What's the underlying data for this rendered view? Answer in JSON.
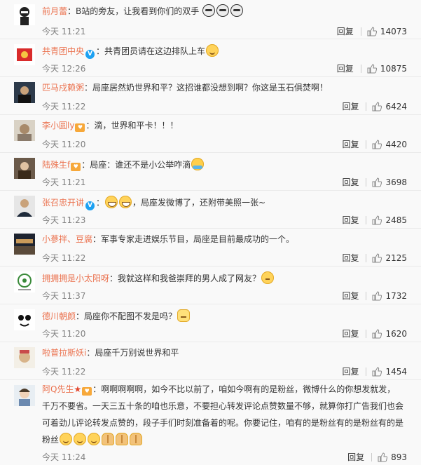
{
  "ui": {
    "reply_label": "回复",
    "colon": "："
  },
  "comments": [
    {
      "user": "前月蕾",
      "text": "B站的旁友，让我看到你们的双手",
      "time": "今天 11:21",
      "likes": "14073"
    },
    {
      "user": "共青团中央",
      "text": "共青团员请在这边排队上车",
      "time": "今天 12:26",
      "likes": "10875"
    },
    {
      "user": "匹马戍赖粥",
      "text": "局座居然奶世界和平？这招谁都没想到啊？你这是玉石俱焚啊！",
      "time": "今天 11:22",
      "likes": "6424"
    },
    {
      "user": "李小圆ly",
      "text": "滴，世界和平卡！！！",
      "time": "今天 11:20",
      "likes": "4420"
    },
    {
      "user": "陆殊生f",
      "text": "局座：谁还不是小公举咋滴",
      "time": "今天 11:21",
      "likes": "3698"
    },
    {
      "user": "张召忠开讲",
      "text": "，局座发微博了，还附带美照一张~",
      "time": "今天 11:23",
      "likes": "2485"
    },
    {
      "user": "小蔘拌、豆腐",
      "text": "军事专家走进娱乐节目，局座是目前最成功的一个。",
      "time": "今天 11:22",
      "likes": "2125"
    },
    {
      "user": "拥拥拥是小太阳呀",
      "text": "我就这样和我爸崇拜的男人成了网友？",
      "time": "今天 11:37",
      "likes": "1732"
    },
    {
      "user": "德川朝颜",
      "text": "局座你不配图不发是吗？",
      "time": "今天 11:20",
      "likes": "1620"
    },
    {
      "user": "啦普拉斯妖i",
      "text": "局座千万别说世界和平",
      "time": "今天 11:22",
      "likes": "1454"
    },
    {
      "user": "阿Q先生",
      "text_line1": "啊啊啊啊啊，如今不比以前了，咱如今啊有的是粉丝，微博什么的你想发就发，",
      "text_line2": "千万不要省。一天三五十条的咱也乐意，不要担心转发评论点赞数量不够，就算你打广告我们也会",
      "text_line3": "可着劲儿评论转发点赞的，段子手们时刻准备着的呢。你要记住，咱有的是粉丝有的是粉丝有的是",
      "text_line4": "粉丝",
      "time": "今天 11:24",
      "likes": "893"
    }
  ],
  "colors": {
    "username": "#eb7350",
    "time": "#808080",
    "verified": "#1da1f2"
  }
}
